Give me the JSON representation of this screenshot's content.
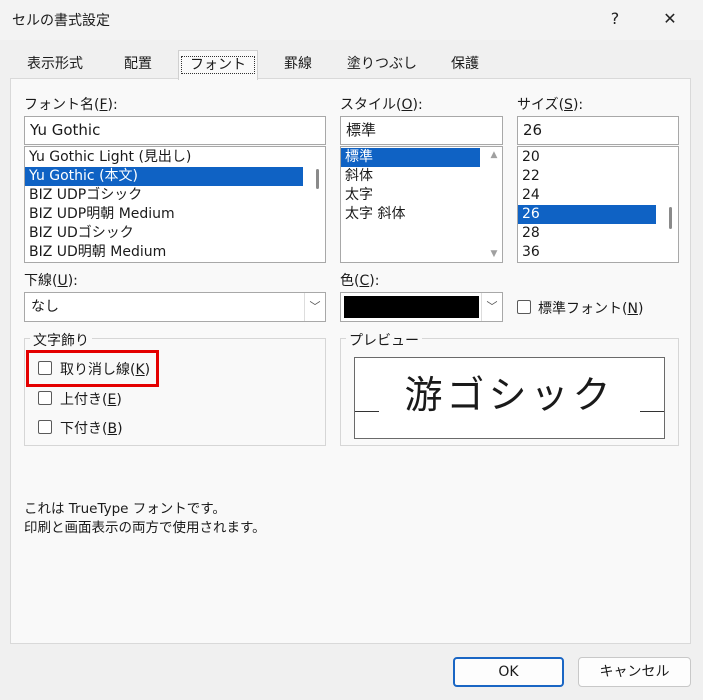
{
  "window": {
    "title": "セルの書式設定",
    "help_label": "?",
    "close_label": "✕"
  },
  "tabs": [
    {
      "label": "表示形式"
    },
    {
      "label": "配置"
    },
    {
      "label": "フォント"
    },
    {
      "label": "罫線"
    },
    {
      "label": "塗りつぶし"
    },
    {
      "label": "保護"
    }
  ],
  "font_name": {
    "label_text": "フォント名(",
    "label_key": "F",
    "label_end": "):",
    "value": "Yu Gothic",
    "items": [
      "Yu Gothic Light (見出し)",
      "Yu Gothic (本文)",
      "BIZ UDPゴシック",
      "BIZ UDP明朝 Medium",
      "BIZ UDゴシック",
      "BIZ UD明朝 Medium"
    ],
    "selected_index": 1
  },
  "style": {
    "label_text": "スタイル(",
    "label_key": "O",
    "label_end": "):",
    "value": "標準",
    "items": [
      "標準",
      "斜体",
      "太字",
      "太字 斜体"
    ],
    "selected_index": 0
  },
  "size": {
    "label_text": "サイズ(",
    "label_key": "S",
    "label_end": "):",
    "value": "26",
    "items": [
      "20",
      "22",
      "24",
      "26",
      "28",
      "36"
    ],
    "selected_index": 3
  },
  "underline": {
    "label_text": "下線(",
    "label_key": "U",
    "label_end": "):",
    "value": "なし"
  },
  "color": {
    "label_text": "色(",
    "label_key": "C",
    "label_end": "):",
    "swatch": "#000000"
  },
  "normal_font": {
    "label_text": "標準フォント(",
    "label_key": "N",
    "label_end": ")",
    "checked": false
  },
  "effects": {
    "title": "文字飾り",
    "strikethrough": {
      "label_text": "取り消し線(",
      "label_key": "K",
      "label_end": ")",
      "checked": false
    },
    "superscript": {
      "label_text": "上付き(",
      "label_key": "E",
      "label_end": ")",
      "checked": false
    },
    "subscript": {
      "label_text": "下付き(",
      "label_key": "B",
      "label_end": ")",
      "checked": false
    }
  },
  "preview": {
    "title": "プレビュー",
    "sample": "游ゴシック"
  },
  "info": {
    "line1": "これは TrueType フォントです。",
    "line2": "印刷と画面表示の両方で使用されます。"
  },
  "buttons": {
    "ok": "OK",
    "cancel": "キャンセル"
  },
  "colors": {
    "selection": "#0f62c4",
    "highlight": "#e40000",
    "default_border": "#1a66c4"
  }
}
